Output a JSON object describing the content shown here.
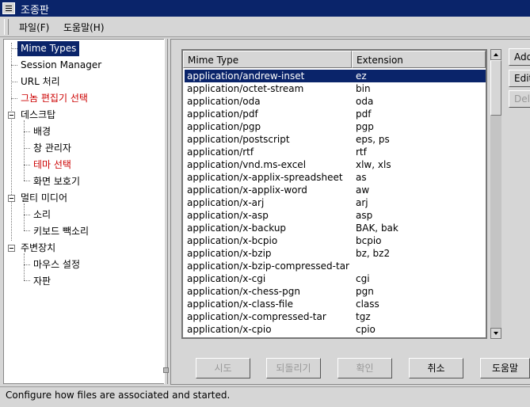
{
  "window": {
    "title": "조종판"
  },
  "menubar": {
    "items": [
      {
        "label": "파일(F)"
      },
      {
        "label": "도움말(H)"
      }
    ]
  },
  "sidebar": {
    "items": [
      {
        "label": "Mime Types",
        "selected": true
      },
      {
        "label": "Session Manager"
      },
      {
        "label": "URL 처리"
      },
      {
        "label": "그놈 편집기 선택",
        "color": "#cc0000"
      },
      {
        "label": "데스크탑"
      },
      {
        "label": "배경"
      },
      {
        "label": "창 관리자"
      },
      {
        "label": "테마 선택",
        "color": "#cc0000"
      },
      {
        "label": "화면 보호기"
      },
      {
        "label": "멀티 미디어"
      },
      {
        "label": "소리"
      },
      {
        "label": "키보드 빽소리"
      },
      {
        "label": "주변장치"
      },
      {
        "label": "마우스 설정"
      },
      {
        "label": "자판"
      }
    ]
  },
  "table": {
    "columns": [
      "Mime Type",
      "Extension"
    ],
    "rows": [
      [
        "application/andrew-inset",
        "ez"
      ],
      [
        "application/octet-stream",
        "bin"
      ],
      [
        "application/oda",
        "oda"
      ],
      [
        "application/pdf",
        "pdf"
      ],
      [
        "application/pgp",
        "pgp"
      ],
      [
        "application/postscript",
        "eps, ps"
      ],
      [
        "application/rtf",
        "rtf"
      ],
      [
        "application/vnd.ms-excel",
        "xlw, xls"
      ],
      [
        "application/x-applix-spreadsheet",
        "as"
      ],
      [
        "application/x-applix-word",
        "aw"
      ],
      [
        "application/x-arj",
        "arj"
      ],
      [
        "application/x-asp",
        "asp"
      ],
      [
        "application/x-backup",
        "BAK, bak"
      ],
      [
        "application/x-bcpio",
        "bcpio"
      ],
      [
        "application/x-bzip",
        "bz, bz2"
      ],
      [
        "application/x-bzip-compressed-tar",
        ""
      ],
      [
        "application/x-cgi",
        "cgi"
      ],
      [
        "application/x-chess-pgn",
        "pgn"
      ],
      [
        "application/x-class-file",
        "class"
      ],
      [
        "application/x-compressed-tar",
        "tgz"
      ],
      [
        "application/x-cpio",
        "cpio"
      ]
    ]
  },
  "side_buttons": {
    "add": "Add",
    "edit": "Edit",
    "delete": "Del"
  },
  "buttons": {
    "try": "시도",
    "revert": "되돌리기",
    "ok": "확인",
    "cancel": "취소",
    "help": "도움말"
  },
  "status": {
    "text": "Configure how files are associated and started."
  },
  "colors": {
    "selection": "#0a246a",
    "highlight_text": "#cc0000",
    "background": "#d6d6d6"
  }
}
